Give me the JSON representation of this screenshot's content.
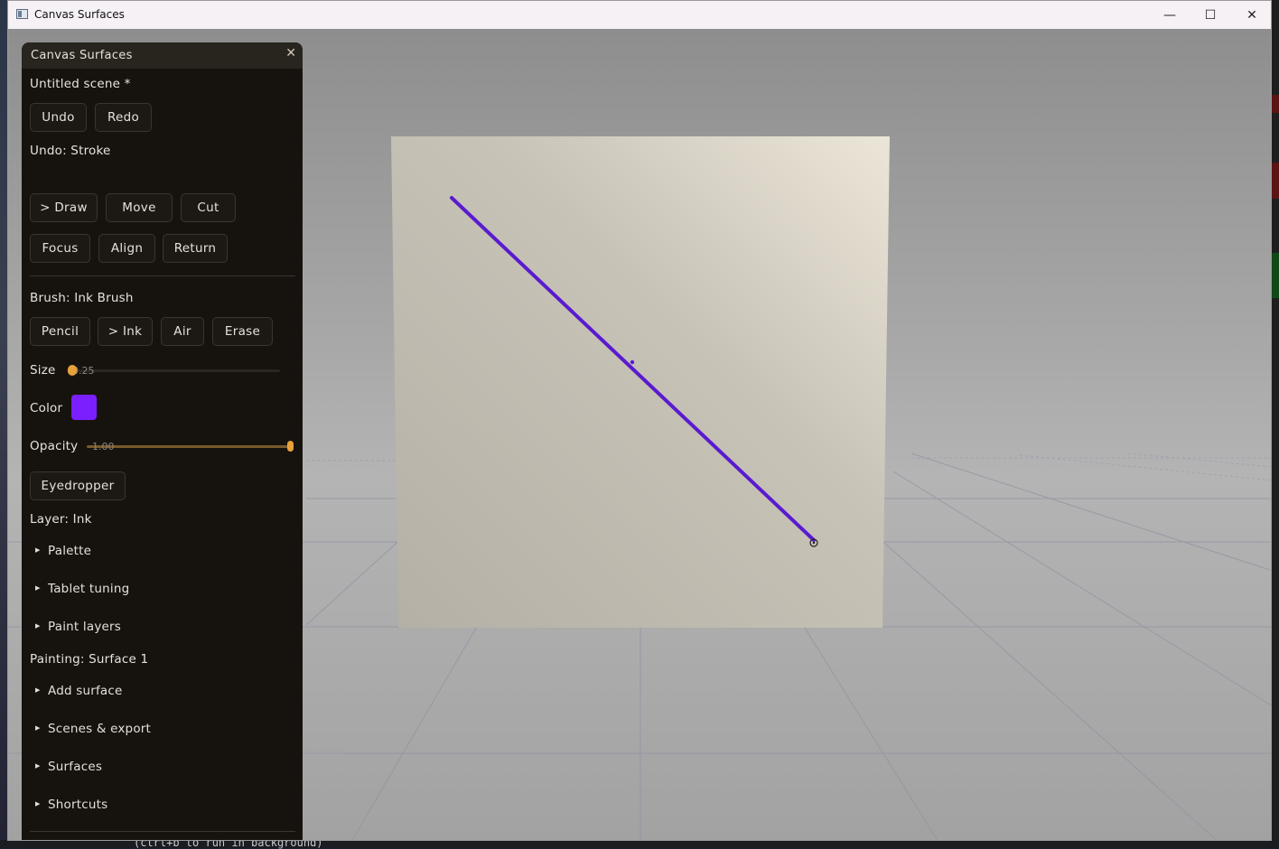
{
  "window": {
    "title": "Canvas Surfaces"
  },
  "panel": {
    "title": "Canvas Surfaces",
    "scene_name": "Untitled scene *",
    "undo_label": "Undo",
    "redo_label": "Redo",
    "undo_status": "Undo: Stroke",
    "tools": [
      {
        "label": "> Draw",
        "active": true
      },
      {
        "label": "Move",
        "active": false
      },
      {
        "label": "Cut",
        "active": false
      },
      {
        "label": "Focus",
        "active": false
      },
      {
        "label": "Align",
        "active": false
      },
      {
        "label": "Return",
        "active": false
      }
    ],
    "brush_status": "Brush: Ink Brush",
    "brushes": [
      {
        "label": "Pencil",
        "active": false
      },
      {
        "label": "> Ink",
        "active": true
      },
      {
        "label": "Air",
        "active": false
      },
      {
        "label": "Erase",
        "active": false
      }
    ],
    "size": {
      "label": "Size",
      "value": 0.25,
      "value_text": "0.25"
    },
    "color": {
      "label": "Color",
      "value": "#7b1fff"
    },
    "opacity": {
      "label": "Opacity",
      "value": 1.0,
      "value_text": "1.00"
    },
    "eyedropper_label": "Eyedropper",
    "layer_status": "Layer: Ink",
    "layer_sections": [
      "Palette",
      "Tablet tuning",
      "Paint layers"
    ],
    "painting_status": "Painting: Surface 1",
    "painting_sections": [
      "Add surface",
      "Scenes & export",
      "Surfaces",
      "Shortcuts"
    ]
  },
  "stroke": {
    "color": "#5a1ad0"
  },
  "background": {
    "terminal_text": "(ctrl+b to run in background)"
  },
  "colors": {
    "accent": "#e8a23a",
    "panel_bg": "#16130f"
  }
}
